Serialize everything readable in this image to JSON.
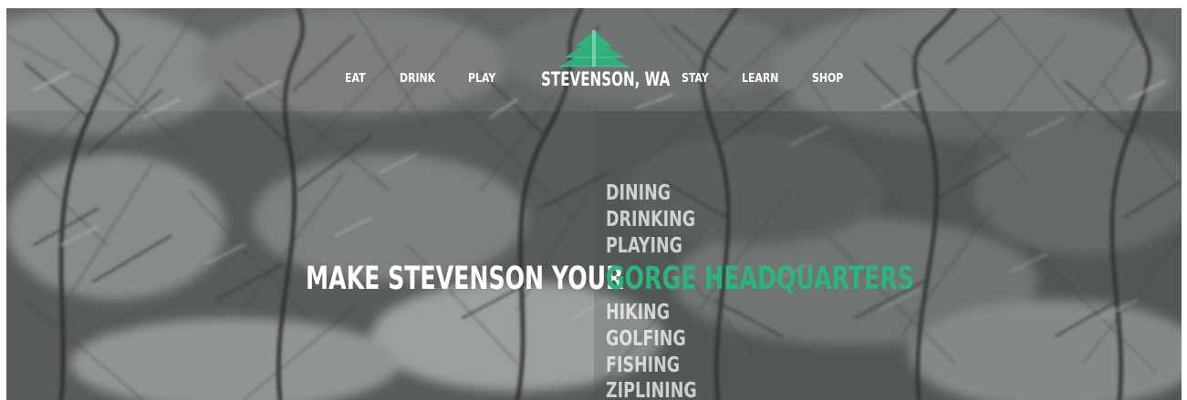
{
  "nav": {
    "left": [
      "EAT",
      "DRINK",
      "PLAY"
    ],
    "right": [
      "STAY",
      "LEARN",
      "SHOP"
    ]
  },
  "logo": {
    "text": "STEVENSON, WA",
    "icon": "tree-icon",
    "color": "#2fb37a"
  },
  "hero": {
    "tagline": "MAKE STEVENSON YOUR",
    "words_above": [
      "DINING",
      "DRINKING",
      "PLAYING"
    ],
    "highlight": "GORGE HEADQUARTERS",
    "words_below": [
      "HIKING",
      "GOLFING",
      "FISHING",
      "ZIPLINING"
    ],
    "highlight_color": "#2fb37a"
  }
}
